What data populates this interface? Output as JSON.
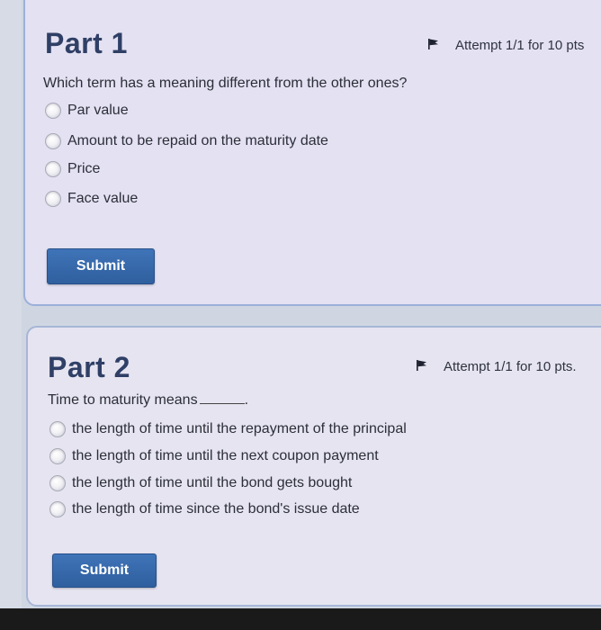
{
  "part1": {
    "title": "Part 1",
    "attempt": "Attempt 1/1 for 10 pts",
    "question": "Which term has a meaning different from the other ones?",
    "options": [
      "Par value",
      "Amount to be repaid on the maturity date",
      "Price",
      "Face value"
    ],
    "submit_label": "Submit"
  },
  "part2": {
    "title": "Part 2",
    "attempt": "Attempt 1/1 for 10 pts.",
    "question": "Time to maturity means",
    "question_suffix": ".",
    "options": [
      "the length of time until the repayment of the principal",
      "the length of time until the next coupon payment",
      "the length of time until the bond gets bought",
      "the length of time since the bond's issue date"
    ],
    "submit_label": "Submit"
  },
  "colors": {
    "card_background": "#e4e1f2",
    "title_color": "#2f3f66",
    "button_color": "#3a6aad"
  },
  "icons": {
    "attempt": "flag-icon",
    "option": "radio-button-unselected"
  }
}
